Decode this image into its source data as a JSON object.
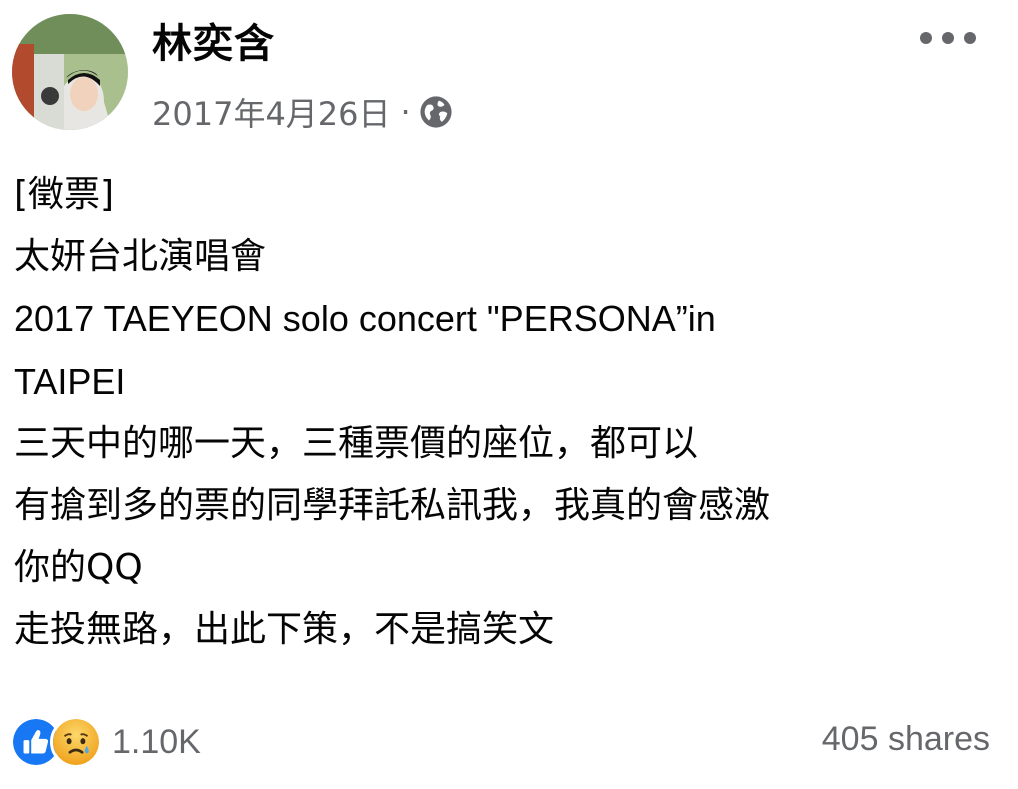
{
  "post": {
    "author": "林奕含",
    "date": "2017年4月26日",
    "separator": "·",
    "privacy_icon": "globe-icon",
    "more_icon": "more-options-icon",
    "lines": [
      "[徵票]",
      "太妍台北演唱會",
      "2017 TAEYEON solo concert \"PERSONA”in",
      "TAIPEI",
      "三天中的哪一天，三種票價的座位，都可以",
      "有搶到多的票的同學拜託私訊我，我真的會感激",
      "你的QQ",
      "走投無路，出此下策，不是搞笑文"
    ]
  },
  "footer": {
    "reactions": [
      "like-icon",
      "sad-icon"
    ],
    "reaction_count": "1.10K",
    "shares": "405 shares"
  },
  "colors": {
    "like_blue": "#1877f2",
    "sad_yellow": "#f7b125",
    "secondary_text": "#65676b"
  }
}
